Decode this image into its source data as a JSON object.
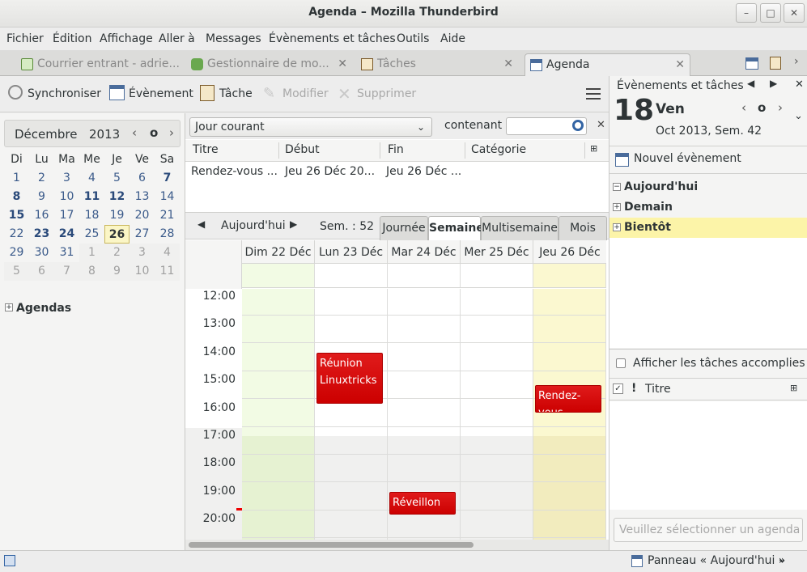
{
  "window": {
    "title": "Agenda – Mozilla Thunderbird"
  },
  "menu": [
    "Fichier",
    "Édition",
    "Affichage",
    "Aller à",
    "Messages",
    "Évènements et tâches",
    "Outils",
    "Aide"
  ],
  "tabs": [
    {
      "label": "Courrier entrant - adrie...",
      "icon": "inbox-icon"
    },
    {
      "label": "Gestionnaire de mo...",
      "icon": "puzzle-icon"
    },
    {
      "label": "Tâches",
      "icon": "tasks-icon"
    },
    {
      "label": "Agenda",
      "icon": "calendar-icon"
    }
  ],
  "toolbar": {
    "sync": "Synchroniser",
    "event": "Évènement",
    "task": "Tâche",
    "modify": "Modifier",
    "delete": "Supprimer"
  },
  "minical": {
    "month": "Décembre",
    "year": "2013",
    "today_btn": "o",
    "weekdays": [
      "Di",
      "Lu",
      "Ma",
      "Me",
      "Je",
      "Ve",
      "Sa"
    ],
    "weeks": [
      [
        "1",
        "2",
        "3",
        "4",
        "5",
        "6",
        "7"
      ],
      [
        "8",
        "9",
        "10",
        "11",
        "12",
        "13",
        "14"
      ],
      [
        "15",
        "16",
        "17",
        "18",
        "19",
        "20",
        "21"
      ],
      [
        "22",
        "23",
        "24",
        "25",
        "26",
        "27",
        "28"
      ],
      [
        "29",
        "30",
        "31",
        "1",
        "2",
        "3",
        "4"
      ],
      [
        "5",
        "6",
        "7",
        "8",
        "9",
        "10",
        "11"
      ]
    ]
  },
  "agendas_label": "Agendas",
  "filter": {
    "range": "Jour courant",
    "containing": "contenant",
    "search_placeholder": ""
  },
  "list": {
    "columns": [
      "Titre",
      "Début",
      "Fin",
      "Catégorie"
    ],
    "rows": [
      {
        "title": "Rendez-vous ...",
        "start": "Jeu 26 Déc 20...",
        "end": "Jeu 26 Déc ...",
        "category": ""
      }
    ]
  },
  "nav": {
    "today": "Aujourd'hui",
    "week": "Sem. : 52",
    "views": [
      "Journée",
      "Semaine",
      "Multisemaine",
      "Mois"
    ],
    "active_view": "Semaine"
  },
  "days": [
    "Dim 22 Déc",
    "Lun 23 Déc",
    "Mar 24 Déc",
    "Mer 25 Déc",
    "Jeu 26 Déc"
  ],
  "hours": [
    "12:00",
    "13:00",
    "14:00",
    "15:00",
    "16:00",
    "17:00",
    "18:00",
    "19:00",
    "20:00"
  ],
  "events": [
    {
      "title": "Réunion Linuxtricks",
      "day": 1,
      "start": "14:00",
      "end": "16:00"
    },
    {
      "title": "Rendez-vous dentiste",
      "day": 4,
      "start": "15:10",
      "end": "16:20"
    },
    {
      "title": "Réveillon de Noël",
      "day": 2,
      "start": "19:00",
      "end": "20:00"
    }
  ],
  "right": {
    "header": "Évènements et tâches",
    "day_num": "18",
    "day_name": "Ven",
    "month_info": "Oct 2013, Sem. 42",
    "new_event": "Nouvel évènement",
    "sections": [
      "Aujourd'hui",
      "Demain",
      "Bientôt"
    ],
    "show_completed": "Afficher les tâches accomplies",
    "tasks_col": "Titre",
    "quick_task_placeholder": "Veuillez sélectionner un agenda qu"
  },
  "status": {
    "panel": "Panneau « Aujourd'hui »"
  },
  "colors": {
    "event": "#cc0000",
    "today_col": "#fbf8d0",
    "weekend_col": "#f2fbe4",
    "soon_bg": "#fcf4a8"
  }
}
